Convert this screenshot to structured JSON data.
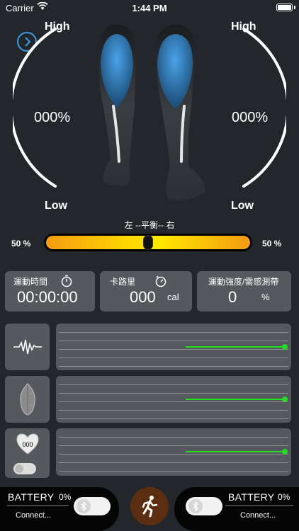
{
  "status_bar": {
    "carrier": "Carrier",
    "time": "1:44 PM"
  },
  "gauges": {
    "left": {
      "high_label": "High",
      "low_label": "Low",
      "value": "000%"
    },
    "right": {
      "high_label": "High",
      "low_label": "Low",
      "value": "000%"
    }
  },
  "balance": {
    "label": "左 --平衡-- 右",
    "left_pct": "50 %",
    "right_pct": "50 %",
    "position": 0.5
  },
  "stats": {
    "time": {
      "title": "運動時間",
      "value": "00:00:00",
      "icon": "stopwatch-icon"
    },
    "calories": {
      "title": "卡路里",
      "value": "000",
      "unit": "cal",
      "icon": "timer-icon"
    },
    "intensity": {
      "title": "運動強度/需感測帶",
      "value": "0",
      "unit": "%"
    }
  },
  "sensors": {
    "emg": {
      "icon": "waveform-icon",
      "level": 0.55
    },
    "muscle": {
      "icon": "muscle-leaf-icon",
      "level": 0.55
    },
    "heart": {
      "icon": "heart-icon",
      "value": "000",
      "level": 0.55
    }
  },
  "battery": {
    "left": {
      "label": "BATTERY",
      "pct": "0%",
      "connect": "Connect..."
    },
    "right": {
      "label": "BATTERY",
      "pct": "0%",
      "connect": "Connect..."
    }
  },
  "colors": {
    "accent_blue": "#3d9be0",
    "signal_green": "#22dd22",
    "card": "#55595d",
    "bg": "#23272b",
    "run_button": "#5b2e12"
  }
}
